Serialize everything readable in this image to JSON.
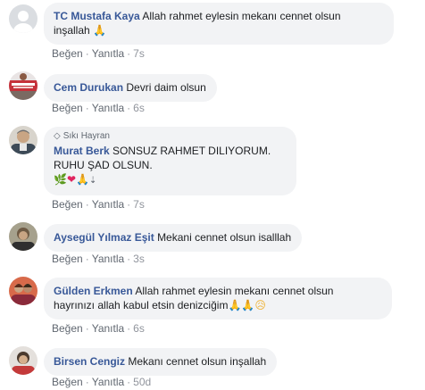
{
  "comments": [
    {
      "author": "TC Mustafa Kaya",
      "text_line1": "Allah rahmet eylesin mekanı cennet olsun",
      "text_line2": "inşallah",
      "emoji": "🙏",
      "like_label": "Beğen",
      "reply_label": "Yanıtla",
      "time": "7s"
    },
    {
      "author": "Cem Durukan",
      "text": "Devri daim olsun",
      "like_label": "Beğen",
      "reply_label": "Yanıtla",
      "time": "6s"
    },
    {
      "badge": "Sıkı Hayran",
      "author": "Murat Berk",
      "text_line1": "SONSUZ RAHMET DILIYORUM.",
      "text_line2": "RUHU ŞAD OLSUN.",
      "emoji_line": "🌿❤🙏⇣",
      "like_label": "Beğen",
      "reply_label": "Yanıtla",
      "time": "7s"
    },
    {
      "author": "Aysegül Yılmaz Eşit",
      "text": "Mekani cennet olsun isalllah",
      "like_label": "Beğen",
      "reply_label": "Yanıtla",
      "time": "3s"
    },
    {
      "author": "Gülden Erkmen",
      "text_line1": "Allah rahmet eylesin mekanı cennet olsun",
      "text_line2": "hayrınızı allah kabul etsin denizciğim",
      "emoji": "🙏🙏😥",
      "like_label": "Beğen",
      "reply_label": "Yanıtla",
      "time": "6s"
    },
    {
      "author": "Birsen Cengiz",
      "text": "Mekanı cennet olsun inşallah",
      "like_label": "Beğen",
      "reply_label": "Yanıtla",
      "time": "50d"
    }
  ],
  "colors": {
    "author": "#385898",
    "bubble": "#f2f3f5",
    "meta": "#606770"
  },
  "icons": {
    "badge": "diamond-icon",
    "avatars": [
      "default-avatar-icon",
      "profile-photo",
      "profile-photo",
      "profile-photo",
      "profile-photo",
      "profile-photo"
    ]
  }
}
